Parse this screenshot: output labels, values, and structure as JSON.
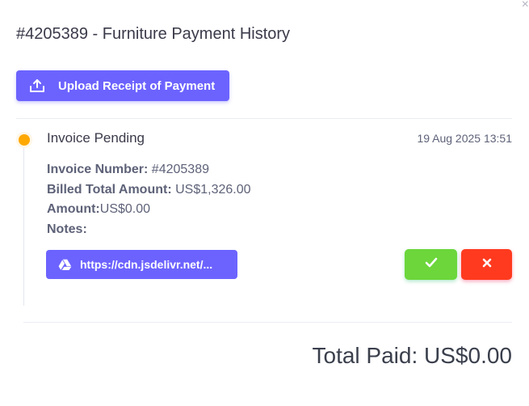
{
  "modal": {
    "close_symbol": "×",
    "title": "#4205389 - Furniture Payment History"
  },
  "upload_button": {
    "label": "Upload Receipt of Payment",
    "icon": "upload-icon"
  },
  "timeline": [
    {
      "status": "Invoice Pending",
      "status_color": "#ffa800",
      "timestamp": "19 Aug 2025 13:51",
      "invoice_number_label": "Invoice Number:",
      "invoice_number": " #4205389",
      "billed_total_label": "Billed Total Amount:",
      "billed_total": " US$1,326.00",
      "amount_label": "Amount:",
      "amount": "US$0.00",
      "notes_label": "Notes:",
      "notes": "",
      "file_link": {
        "label": "https://cdn.jsdelivr.net/...",
        "icon": "google-drive-icon"
      },
      "approve_icon": "check-icon",
      "reject_icon": "close-icon"
    }
  ],
  "total_paid": "Total Paid: US$0.00",
  "colors": {
    "primary": "#6c63ff",
    "success": "#6cd63b",
    "danger": "#ff3a1f",
    "pending": "#ffa800"
  }
}
